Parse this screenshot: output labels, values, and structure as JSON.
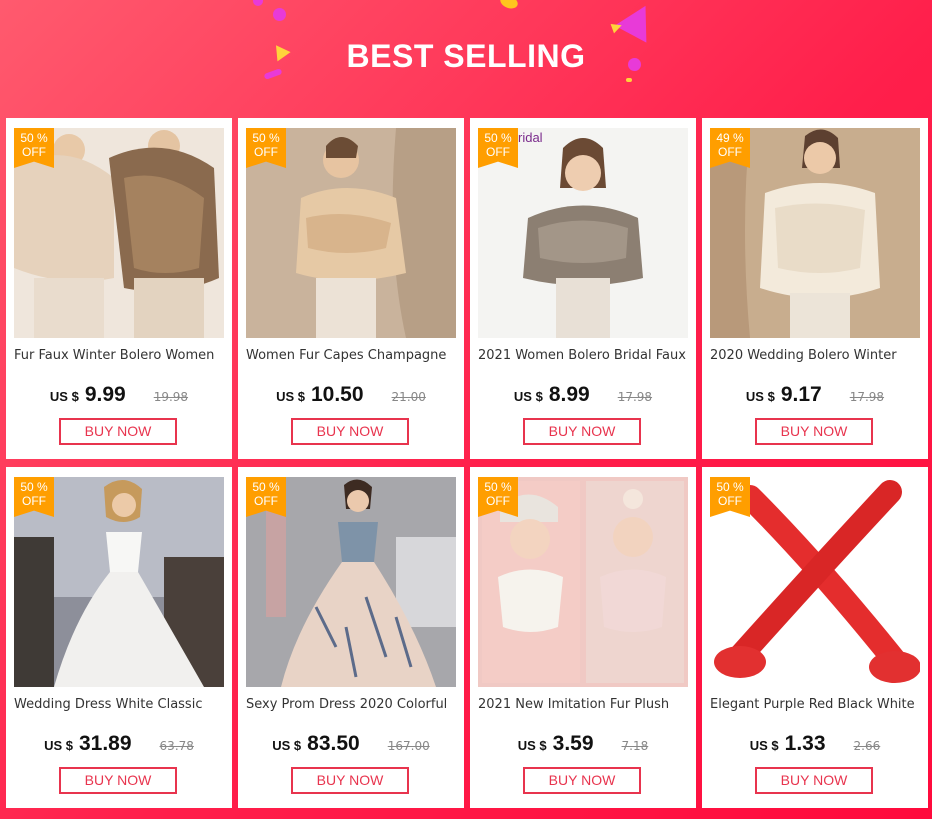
{
  "heading": "BEST SELLING",
  "products": [
    {
      "title": "Fur Faux Winter Bolero Women",
      "discount_pct": "50 %",
      "discount_off": "OFF",
      "currency": "US $",
      "price": "9.99",
      "old_price": "19.98",
      "buy": "BUY NOW",
      "image": "fur-shawl-two-models"
    },
    {
      "title": "Women Fur Capes Champagne",
      "discount_pct": "50 %",
      "discount_off": "OFF",
      "currency": "US $",
      "price": "10.50",
      "old_price": "21.00",
      "buy": "BUY NOW",
      "image": "champagne-fur-cape"
    },
    {
      "title": "2021 Women Bolero Bridal Faux",
      "discount_pct": "50 %",
      "discount_off": "OFF",
      "currency": "US $",
      "price": "8.99",
      "old_price": "17.98",
      "buy": "BUY NOW",
      "image": "grey-bridal-bolero",
      "overlay": "ridal"
    },
    {
      "title": "2020 Wedding Bolero Winter",
      "discount_pct": "49 %",
      "discount_off": "OFF",
      "currency": "US $",
      "price": "9.17",
      "old_price": "17.98",
      "buy": "BUY NOW",
      "image": "ivory-fur-bolero"
    },
    {
      "title": "Wedding Dress White Classic",
      "discount_pct": "50 %",
      "discount_off": "OFF",
      "currency": "US $",
      "price": "31.89",
      "old_price": "63.78",
      "buy": "BUY NOW",
      "image": "white-wedding-dress"
    },
    {
      "title": "Sexy Prom Dress 2020 Colorful",
      "discount_pct": "50 %",
      "discount_off": "OFF",
      "currency": "US $",
      "price": "83.50",
      "old_price": "167.00",
      "buy": "BUY NOW",
      "image": "colorful-prom-dress"
    },
    {
      "title": "2021 New Imitation Fur Plush",
      "discount_pct": "50 %",
      "discount_off": "OFF",
      "currency": "US $",
      "price": "3.59",
      "old_price": "7.18",
      "buy": "BUY NOW",
      "image": "fur-plush-scarves"
    },
    {
      "title": "Elegant Purple Red Black White",
      "discount_pct": "50 %",
      "discount_off": "OFF",
      "currency": "US $",
      "price": "1.33",
      "old_price": "2.66",
      "buy": "BUY NOW",
      "image": "red-long-gloves"
    }
  ],
  "colors": {
    "accent": "#e8344e",
    "badge": "#ff9e00",
    "background": "#ff1f4b"
  }
}
